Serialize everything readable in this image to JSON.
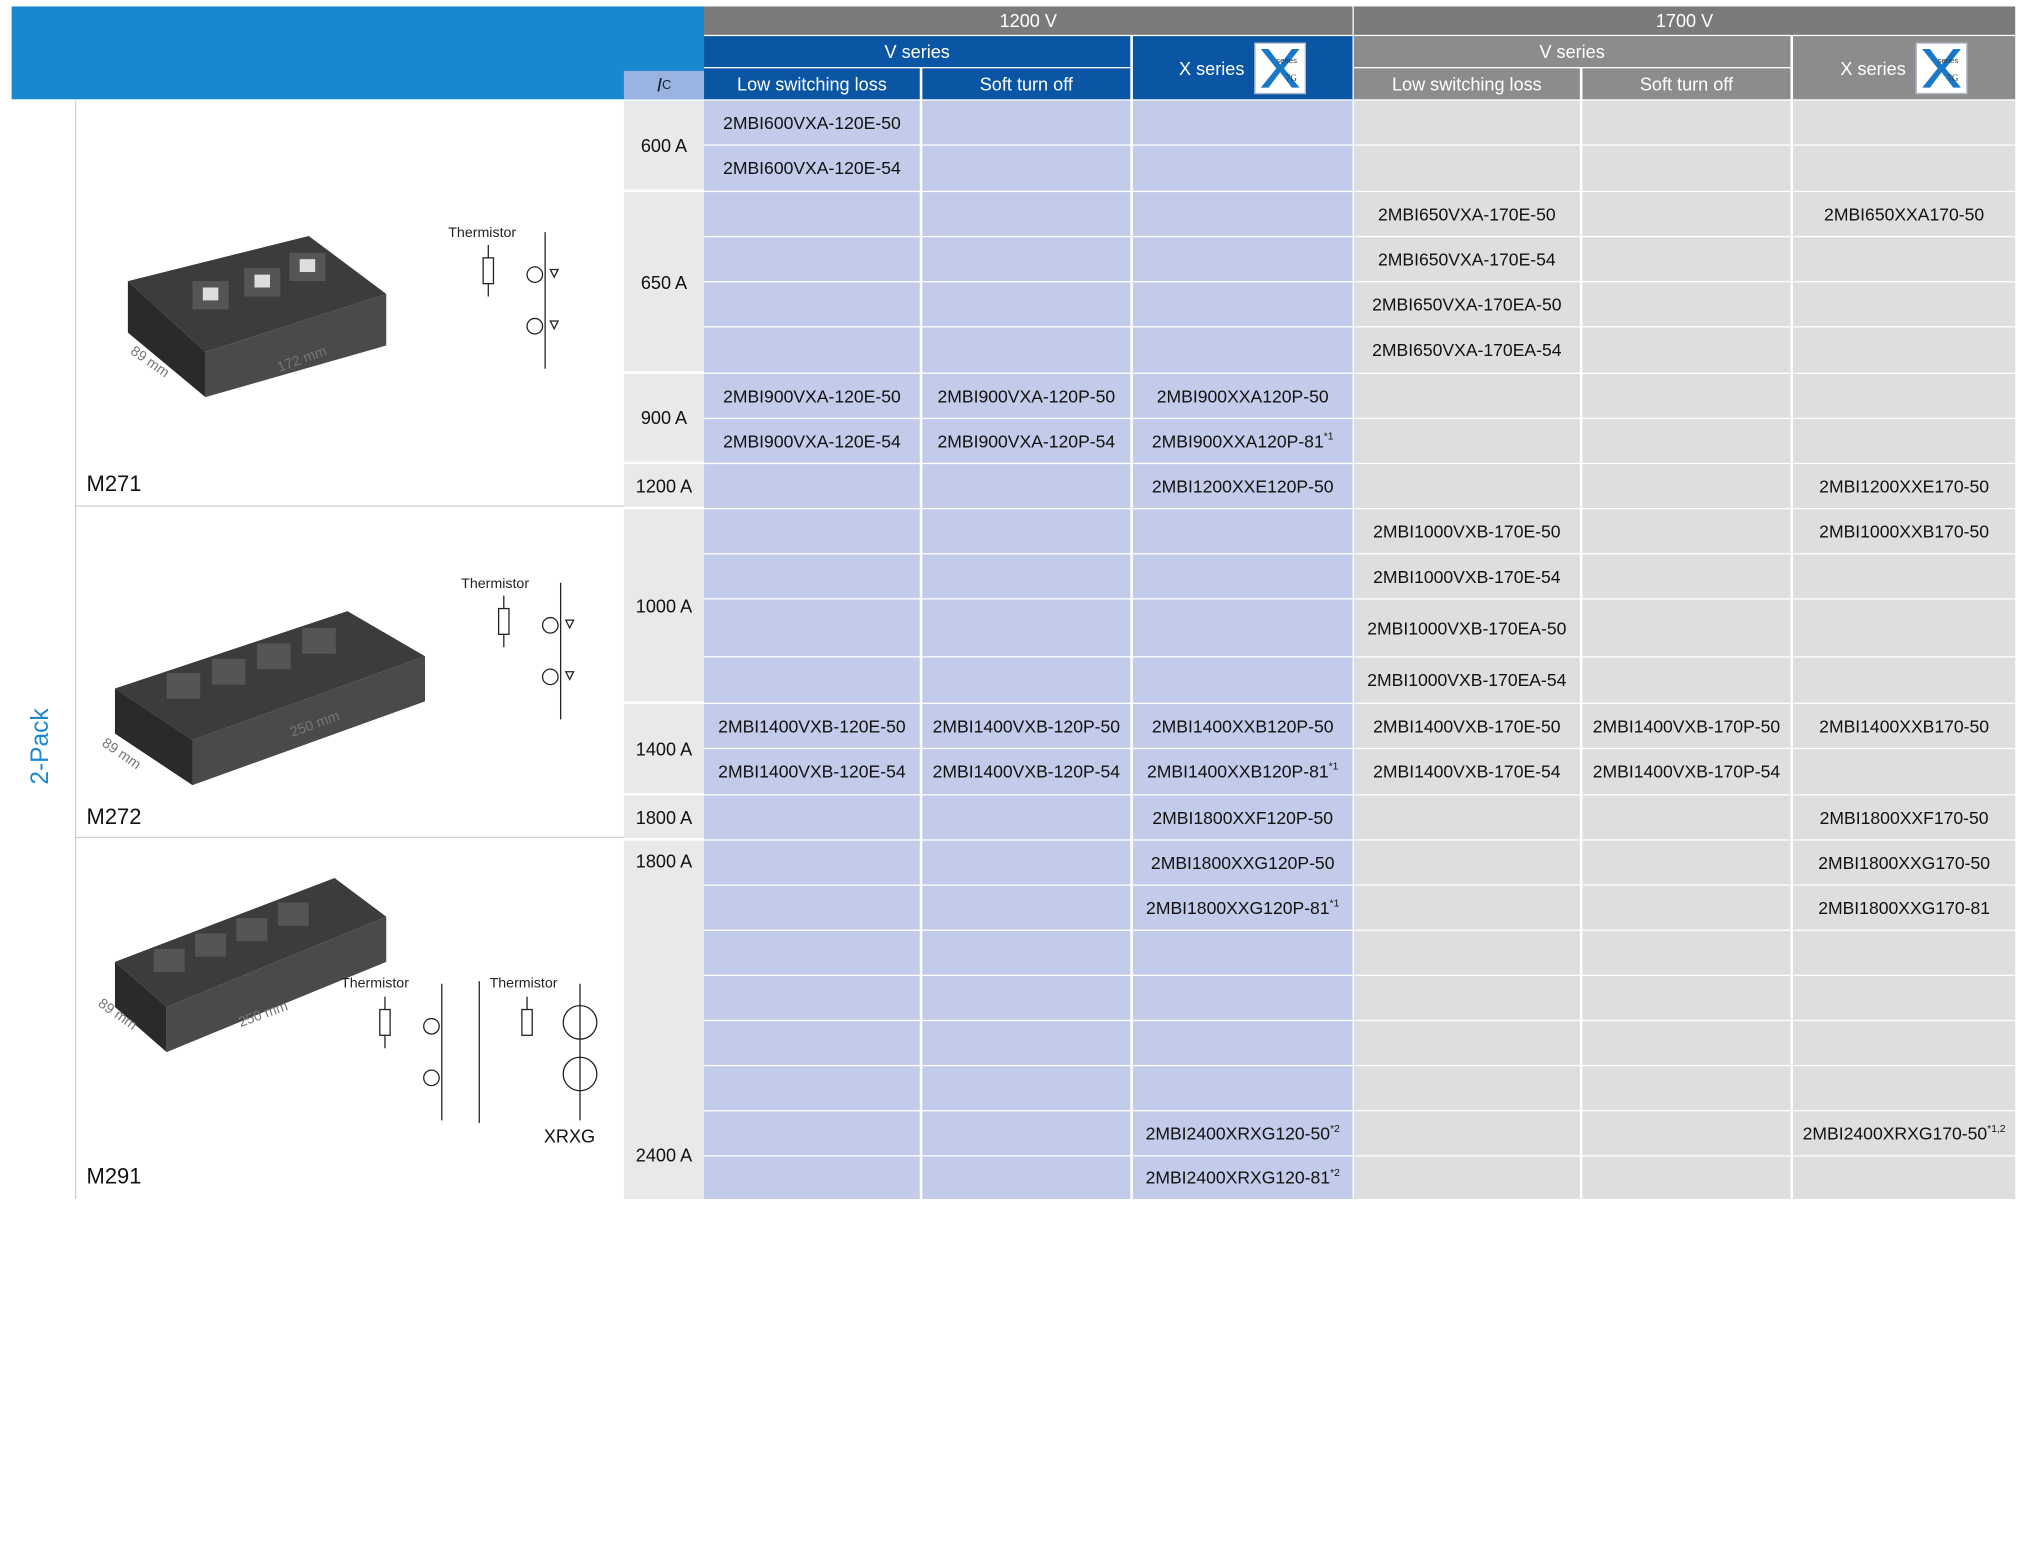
{
  "colors": {
    "header_blue": "#1a88d0",
    "series_dark": "#0a56a5",
    "header_gray": "#7a7a7a",
    "cell_blue": "#c2cbe9",
    "cell_grey": "#dedede"
  },
  "group_label": "2-Pack",
  "header": {
    "v1200": "1200 V",
    "v1700": "1700 V",
    "v_series": "V series",
    "x_series": "X series",
    "low_switching": "Low switching loss",
    "soft_turn_off": "Soft turn off",
    "ic_label": "I",
    "ic_sub": "C",
    "xlogo_text": "series 7G"
  },
  "modules": [
    {
      "name": "M271",
      "dim_w": "89 mm",
      "dim_l": "172 mm",
      "thermistor": "Thermistor"
    },
    {
      "name": "M272",
      "dim_w": "89 mm",
      "dim_l": "250 mm",
      "thermistor": "Thermistor"
    },
    {
      "name": "M291",
      "dim_w": "89 mm",
      "dim_l": "250 mm",
      "thermistor": "Thermistor",
      "thermistor2": "Thermistor",
      "variant": "XRXG"
    }
  ],
  "currents": [
    "600 A",
    "650 A",
    "900 A",
    "1200 A",
    "1000 A",
    "1400 A",
    "1800 A",
    "1800 A",
    "2400 A"
  ],
  "rows": [
    [
      "2MBI600VXA-120E-50",
      "",
      "",
      "",
      "",
      ""
    ],
    [
      "2MBI600VXA-120E-54",
      "",
      "",
      "",
      "",
      ""
    ],
    [
      "",
      "",
      "",
      "2MBI650VXA-170E-50",
      "",
      "2MBI650XXA170-50"
    ],
    [
      "",
      "",
      "",
      "2MBI650VXA-170E-54",
      "",
      ""
    ],
    [
      "",
      "",
      "",
      "2MBI650VXA-170EA-50",
      "",
      ""
    ],
    [
      "",
      "",
      "",
      "2MBI650VXA-170EA-54",
      "",
      ""
    ],
    [
      "2MBI900VXA-120E-50",
      "2MBI900VXA-120P-50",
      "2MBI900XXA120P-50",
      "",
      "",
      ""
    ],
    [
      "2MBI900VXA-120E-54",
      "2MBI900VXA-120P-54",
      "2MBI900XXA120P-81",
      "",
      "",
      ""
    ],
    [
      "",
      "",
      "2MBI1200XXE120P-50",
      "",
      "",
      "2MBI1200XXE170-50"
    ],
    [
      "",
      "",
      "",
      "2MBI1000VXB-170E-50",
      "",
      "2MBI1000XXB170-50"
    ],
    [
      "",
      "",
      "",
      "2MBI1000VXB-170E-54",
      "",
      ""
    ],
    [
      "",
      "",
      "",
      "2MBI1000VXB-170EA-50",
      "",
      ""
    ],
    [
      "",
      "",
      "",
      "2MBI1000VXB-170EA-54",
      "",
      ""
    ],
    [
      "2MBI1400VXB-120E-50",
      "2MBI1400VXB-120P-50",
      "2MBI1400XXB120P-50",
      "2MBI1400VXB-170E-50",
      "2MBI1400VXB-170P-50",
      "2MBI1400XXB170-50"
    ],
    [
      "2MBI1400VXB-120E-54",
      "2MBI1400VXB-120P-54",
      "2MBI1400XXB120P-81",
      "2MBI1400VXB-170E-54",
      "2MBI1400VXB-170P-54",
      ""
    ],
    [
      "",
      "",
      "2MBI1800XXF120P-50",
      "",
      "",
      "2MBI1800XXF170-50"
    ],
    [
      "",
      "",
      "2MBI1800XXG120P-50",
      "",
      "",
      "2MBI1800XXG170-50"
    ],
    [
      "",
      "",
      "2MBI1800XXG120P-81",
      "",
      "",
      "2MBI1800XXG170-81"
    ],
    [
      "",
      "",
      "",
      "",
      "",
      ""
    ],
    [
      "",
      "",
      "",
      "",
      "",
      ""
    ],
    [
      "",
      "",
      "",
      "",
      "",
      ""
    ],
    [
      "",
      "",
      "",
      "",
      "",
      ""
    ],
    [
      "",
      "",
      "2MBI2400XRXG120-50",
      "",
      "",
      "2MBI2400XRXG170-50"
    ],
    [
      "",
      "",
      "2MBI2400XRXG120-81",
      "",
      "",
      ""
    ]
  ],
  "footnotes": {
    "r7c2": "*1",
    "r14c2": "*1",
    "r17c2": "*1",
    "r22c2": "*2",
    "r22c5": "*1,2",
    "r23c2": "*2"
  }
}
